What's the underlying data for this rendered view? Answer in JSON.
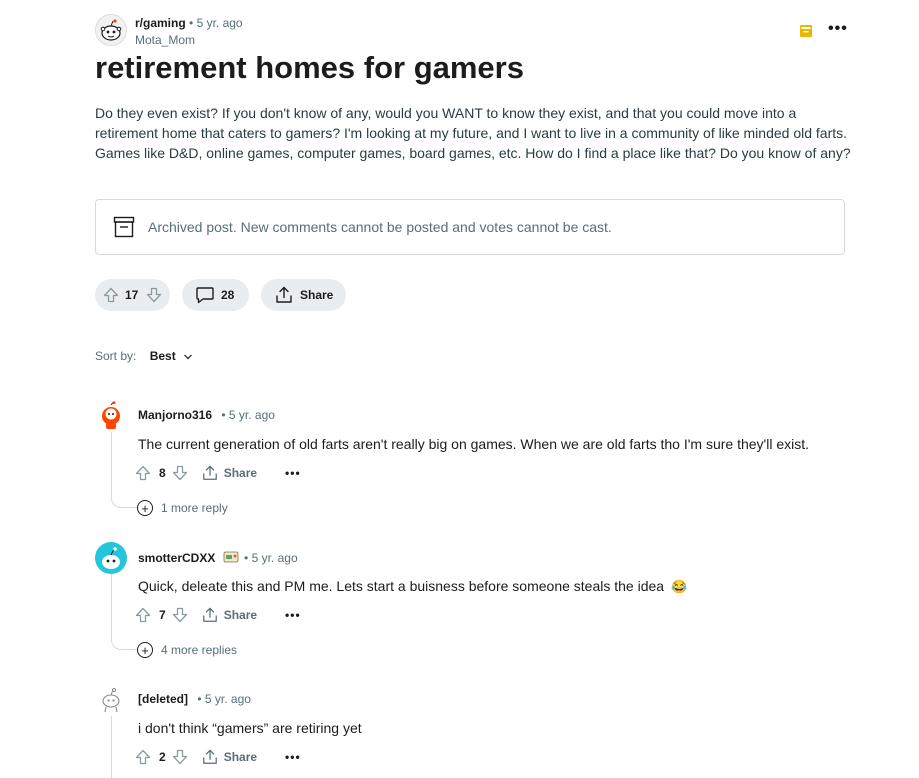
{
  "post": {
    "subreddit": "r/gaming",
    "separator": "•",
    "time": "5 yr. ago",
    "author": "Mota_Mom",
    "more_icon": "more-horizontal-icon",
    "title": "retirement homes for gamers",
    "body": "Do they even exist? If you don't know of any, would you WANT to know they exist, and that you could move into a retirement home that caters to gamers? I'm looking at my future, and I want to live in a community of like minded old farts. Games like D&D, online games, computer games, board games, etc. How do I find a place like that? Do you know of any?",
    "archived_notice": "Archived post. New comments cannot be posted and votes cannot be cast.",
    "upvotes": "17",
    "comments": "28",
    "share_label": "Share",
    "more_dots": "•••"
  },
  "sort": {
    "label": "Sort by:",
    "value": "Best"
  },
  "comments": [
    {
      "user": "Manjorno316",
      "time": "• 5 yr. ago",
      "body": "The current generation of old farts aren't really big on games. When we are old farts tho I'm sure they'll exist.",
      "votes": "8",
      "share": "Share",
      "dots": "•••",
      "more_replies": "1 more reply"
    },
    {
      "user": "smotterCDXX",
      "time": "• 5 yr. ago",
      "body": "Quick, deleate this and PM me. Lets start a buisness before someone steals the idea",
      "emoji": "😂",
      "votes": "7",
      "share": "Share",
      "dots": "•••",
      "more_replies": "4 more replies"
    },
    {
      "user": "[deleted]",
      "time": "• 5 yr. ago",
      "body": "i don't think “gamers” are retiring yet",
      "votes": "2",
      "share": "Share",
      "dots": "•••"
    }
  ],
  "colors": {
    "text": "#1c1c1c",
    "muted": "#576f76",
    "pill_bg": "#eaedef",
    "border": "#d7dadc",
    "archive_badge": "#e8b800",
    "avatar_orange": "#ff4500",
    "avatar_teal": "#24c6dc"
  }
}
